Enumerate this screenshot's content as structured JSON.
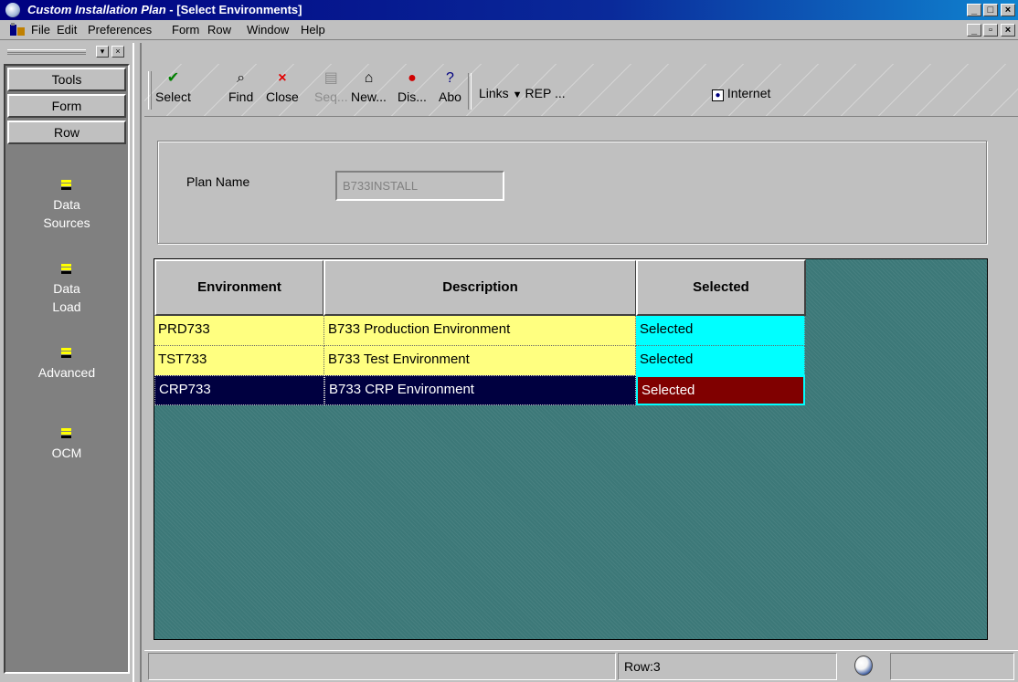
{
  "window": {
    "title_prefix": "Custom Installation Plan",
    "title_suffix": " - [Select Environments]"
  },
  "menu": {
    "items": [
      "File",
      "Edit",
      "Preferences",
      "Form",
      "Row",
      "Window",
      "Help"
    ]
  },
  "left_pane": {
    "tabs": [
      "Tools",
      "Form",
      "Row"
    ],
    "items": [
      {
        "label_line1": "Data",
        "label_line2": "Sources"
      },
      {
        "label_line1": "Data",
        "label_line2": "Load"
      },
      {
        "label_line1": "Advanced",
        "label_line2": ""
      },
      {
        "label_line1": "OCM",
        "label_line2": ""
      }
    ]
  },
  "toolbar": {
    "select": "Select",
    "find": "Find",
    "close": "Close",
    "seq": "Seq...",
    "new": "New...",
    "dis": "Dis...",
    "abo": "Abo",
    "links": "Links",
    "rep": "REP ...",
    "internet": "Internet"
  },
  "form": {
    "plan_name_label": "Plan Name",
    "plan_name_value": "B733INSTALL"
  },
  "grid": {
    "columns": [
      "Environment",
      "Description",
      "Selected"
    ],
    "rows": [
      {
        "environment": "PRD733",
        "description": "B733 Production Environment",
        "selected": "Selected"
      },
      {
        "environment": "TST733",
        "description": "B733 Test Environment",
        "selected": "Selected"
      },
      {
        "environment": "CRP733",
        "description": "B733 CRP Environment",
        "selected": "Selected"
      }
    ]
  },
  "status": {
    "row": "Row:3"
  }
}
